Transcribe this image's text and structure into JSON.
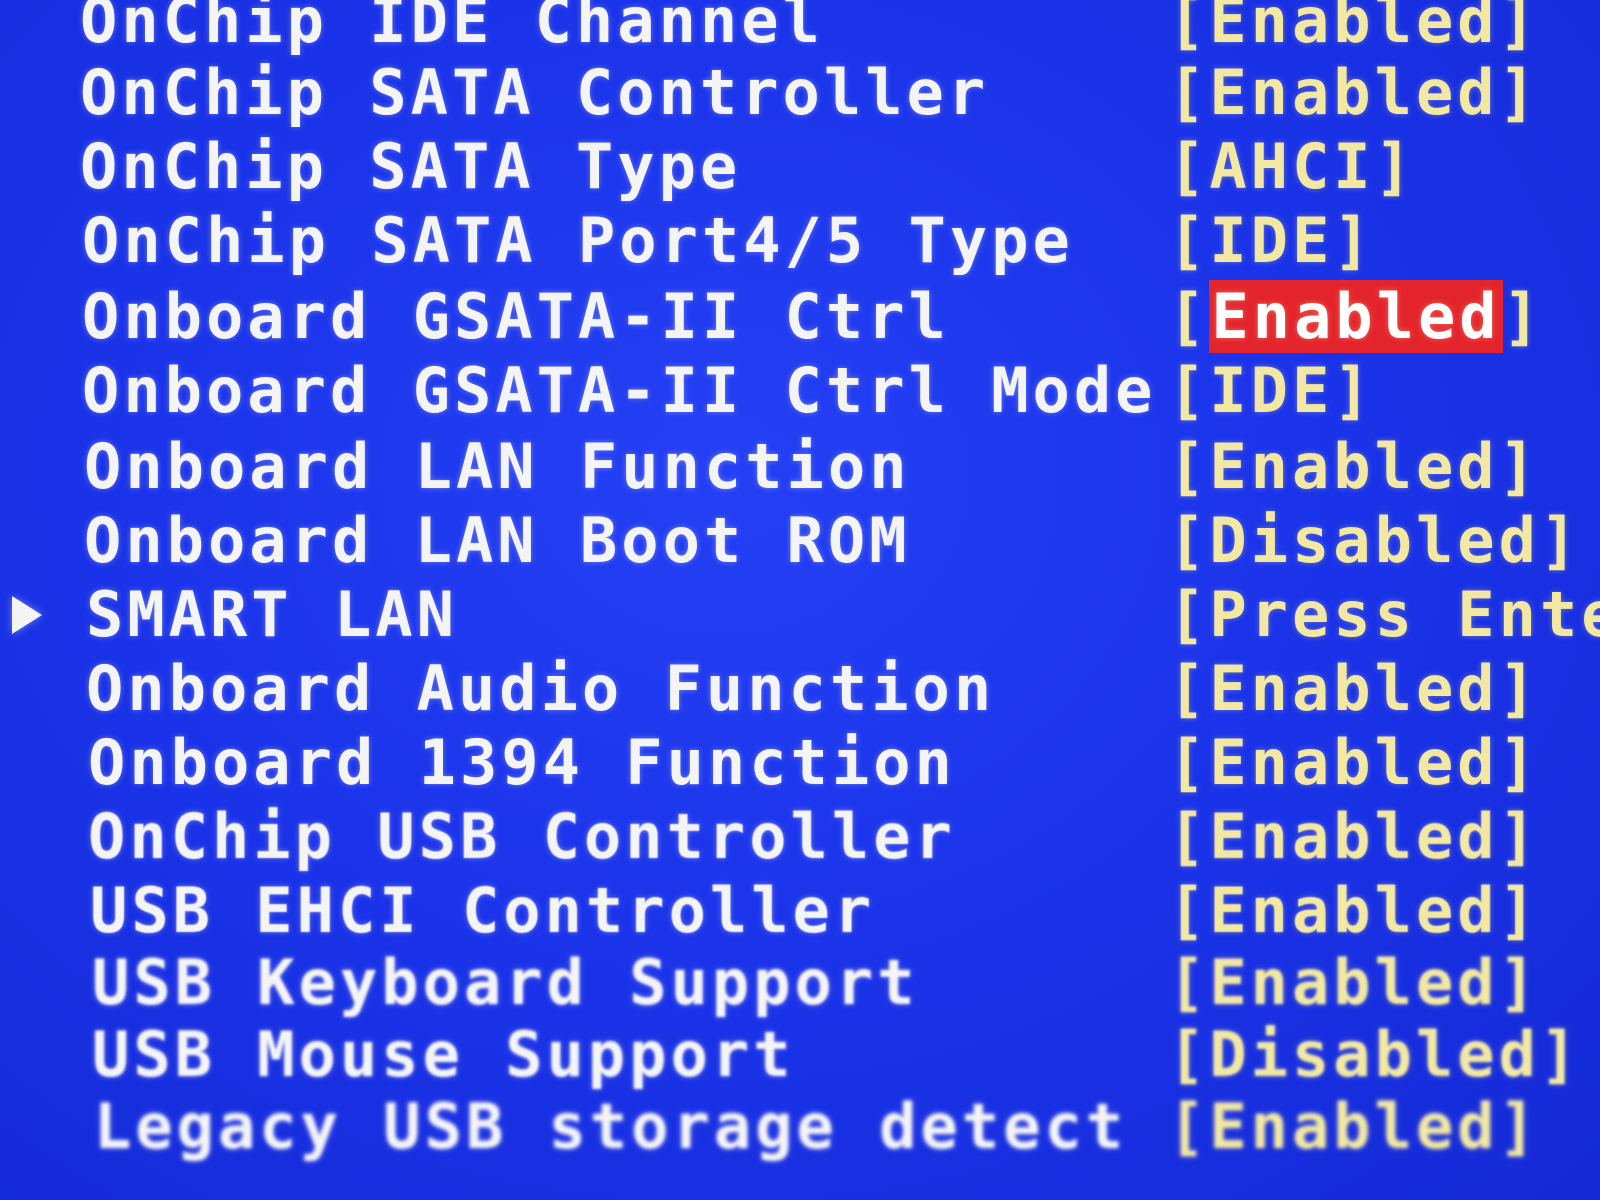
{
  "rows": [
    {
      "label": "OnChip IDE Channel",
      "value": "[Enabled]"
    },
    {
      "label": "OnChip SATA Controller",
      "value": "[Enabled]"
    },
    {
      "label": "OnChip SATA Type",
      "value": "[AHCI]"
    },
    {
      "label": "OnChip SATA Port4/5 Type",
      "value": "[IDE]"
    },
    {
      "label": "Onboard GSATA-II Ctrl",
      "value_open": "[",
      "value_selected": "Enabled",
      "value_close": "]"
    },
    {
      "label": "Onboard GSATA-II Ctrl Mode",
      "value": "[IDE]"
    },
    {
      "label": "Onboard LAN Function",
      "value": "[Enabled]"
    },
    {
      "label": "Onboard LAN Boot ROM",
      "value": "[Disabled]"
    },
    {
      "label": "SMART LAN",
      "value": "[Press Ente"
    },
    {
      "label": "Onboard Audio Function",
      "value": "[Enabled]"
    },
    {
      "label": "Onboard 1394 Function",
      "value": "[Enabled]"
    },
    {
      "label": "OnChip USB Controller",
      "value": "[Enabled]"
    },
    {
      "label": "USB EHCI Controller",
      "value": "[Enabled]"
    },
    {
      "label": "USB Keyboard Support",
      "value": "[Enabled]"
    },
    {
      "label": "USB Mouse Support",
      "value": "[Disabled]"
    },
    {
      "label": "Legacy USB storage detect",
      "value": "[Enabled]"
    }
  ],
  "colors": {
    "background": "#1b34ea",
    "label_text": "#f4f4f4",
    "value_text": "#f2e8a2",
    "highlight": "#e4242c"
  },
  "icons": {
    "submenu_marker": "submenu-arrow-icon"
  }
}
